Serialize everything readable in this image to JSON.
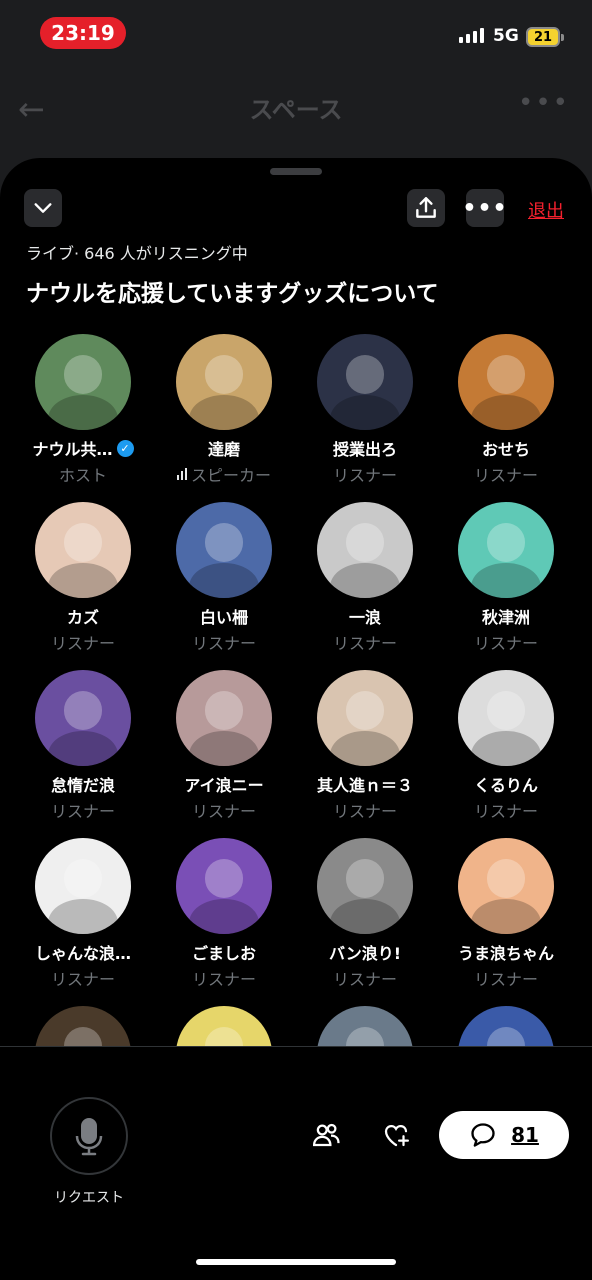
{
  "status_bar": {
    "time": "23:19",
    "network": "5G",
    "battery": "21"
  },
  "background_nav": {
    "title": "スペース"
  },
  "space": {
    "exit_label": "退出",
    "live_status": "ライブ· 646 人がリスニング中",
    "title": "ナウルを応援していますグッズについて"
  },
  "participants": [
    {
      "name": "ナウル共…",
      "role": "ホスト",
      "verified": true,
      "color": "#5f8a5c"
    },
    {
      "name": "達磨",
      "role": "スピーカー",
      "speaking": true,
      "color": "#c9a56a"
    },
    {
      "name": "授業出ろ",
      "role": "リスナー",
      "color": "#2c3247"
    },
    {
      "name": "おせち",
      "role": "リスナー",
      "color": "#c47a35"
    },
    {
      "name": "カズ",
      "role": "リスナー",
      "color": "#e6c9b6"
    },
    {
      "name": "白い柵",
      "role": "リスナー",
      "color": "#4d6aa8"
    },
    {
      "name": "一浪",
      "role": "リスナー",
      "color": "#c9c9c9"
    },
    {
      "name": "秋津洲",
      "role": "リスナー",
      "color": "#5fc9b6"
    },
    {
      "name": "怠惰だ浪",
      "role": "リスナー",
      "color": "#6a4fa0"
    },
    {
      "name": "アイ浪ニー",
      "role": "リスナー",
      "color": "#b79a9a"
    },
    {
      "name": "其人進ｎ＝３",
      "role": "リスナー",
      "color": "#d9c4b0"
    },
    {
      "name": "くるりん",
      "role": "リスナー",
      "color": "#dcdcdc"
    },
    {
      "name": "しゃんな浪…",
      "role": "リスナー",
      "color": "#efefef"
    },
    {
      "name": "ごましお",
      "role": "リスナー",
      "color": "#7a4fb6"
    },
    {
      "name": "バン浪り!",
      "role": "リスナー",
      "color": "#8a8a8a"
    },
    {
      "name": "うま浪ちゃん",
      "role": "リスナー",
      "color": "#f0b48a"
    },
    {
      "name": "",
      "role": "",
      "color": "#4a3a2a"
    },
    {
      "name": "",
      "role": "",
      "color": "#e6d66a"
    },
    {
      "name": "",
      "role": "",
      "color": "#6a7a8a"
    },
    {
      "name": "",
      "role": "",
      "color": "#3a5aa8"
    }
  ],
  "bottom_bar": {
    "request_label": "リクエスト",
    "comment_count": "81"
  },
  "icons": {
    "collapse": "chevron-down-icon",
    "share": "share-icon",
    "more": "more-icon",
    "mic": "microphone-icon",
    "people": "people-icon",
    "reaction": "heart-plus-icon",
    "comment": "comment-icon"
  }
}
